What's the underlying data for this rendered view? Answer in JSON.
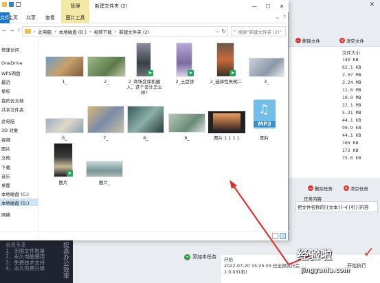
{
  "window": {
    "title": "新建文件夹 (2)",
    "manage_tab": "管理",
    "ribbon_tabs": [
      "文件",
      "主页",
      "共享",
      "查看"
    ],
    "picture_tools": "图片工具"
  },
  "address": {
    "crumbs": [
      "此电脑",
      "本地磁盘 (D:)",
      "视频下载",
      "新建文件夹 (2)"
    ],
    "search_placeholder": "搜索\"新建文件夹 (2)\""
  },
  "sidebar": {
    "items": [
      {
        "label": "快速访问",
        "selected": false
      },
      {
        "label": "OneDrive",
        "selected": false
      },
      {
        "label": "WPS网盘",
        "selected": false
      },
      {
        "label": "最近",
        "selected": false
      },
      {
        "label": "星标",
        "selected": false
      },
      {
        "label": "我的云文档",
        "selected": false
      },
      {
        "label": "共享文件夹",
        "selected": false
      },
      {
        "label": "此电脑",
        "selected": false
      },
      {
        "label": "3D 对象",
        "selected": false
      },
      {
        "label": "视频",
        "selected": false
      },
      {
        "label": "图片",
        "selected": false
      },
      {
        "label": "文档",
        "selected": false
      },
      {
        "label": "下载",
        "selected": false
      },
      {
        "label": "音乐",
        "selected": false
      },
      {
        "label": "桌面",
        "selected": false
      },
      {
        "label": "本地磁盘 (C:)",
        "selected": false
      },
      {
        "label": "本地磁盘 (D:)",
        "selected": true
      },
      {
        "label": "网络",
        "selected": false
      }
    ]
  },
  "files": [
    {
      "name": "1_",
      "badge": false
    },
    {
      "name": "2_",
      "badge": false
    },
    {
      "name": "2_商场变保机器人，这个设计怎么样?",
      "badge": true
    },
    {
      "name": "2_土豆饼",
      "badge": true
    },
    {
      "name": "2_选择性失明二",
      "badge": true
    },
    {
      "name": "4_",
      "badge": false
    },
    {
      "name": "6_",
      "badge": false
    },
    {
      "name": "7_",
      "badge": false
    },
    {
      "name": "8_",
      "badge": false
    },
    {
      "name": "9_",
      "badge": false
    },
    {
      "name": "图片 1 1 1 1",
      "badge": false
    },
    {
      "name": "图片",
      "badge": false
    },
    {
      "name": "图片",
      "badge": true
    },
    {
      "name": "图片_",
      "badge": false
    }
  ],
  "mp3_label": "MP3",
  "bg_app": {
    "delete_file": "删除文件",
    "clear_file": "清空文件",
    "size_header": "文件大小",
    "sizes": [
      "140 KB",
      "62.1 KB",
      "2.07 MB",
      "3.24 MB",
      "11.6 MB",
      "10.9 MB",
      "22.1 MB",
      "5.21 MB",
      "44.1 KB",
      "99.9 KB",
      "44.1 KB",
      "165 KB",
      "172 KB",
      "75.6 KB"
    ],
    "delete_task": "删除任务",
    "clear_task": "清空任务",
    "task_content_label": "任务内容",
    "task_content": "把文件名称的[{文本}]→[{引}]内容",
    "add_task": "添加本任务",
    "log_line1": "开始",
    "log_line2": "2022-07-20 15:25.03 已全部执行完",
    "log_line3": "1 0.031秒)",
    "promo_lines": [
      "会员专享",
      "1、无限文件数量",
      "2、永久电脑使用",
      "3、免费技术支持",
      "4、永久免费升级"
    ],
    "promo_vertical": "提高办公效率",
    "start_exec": "开始执行"
  },
  "watermark": {
    "cn": "经验啦",
    "en": "jingyanla.com"
  },
  "colors": {
    "accent": "#1979ca",
    "manage_highlight": "#f4e8a7",
    "badge_green": "#26a65b",
    "arrow_red": "#e0322a"
  }
}
